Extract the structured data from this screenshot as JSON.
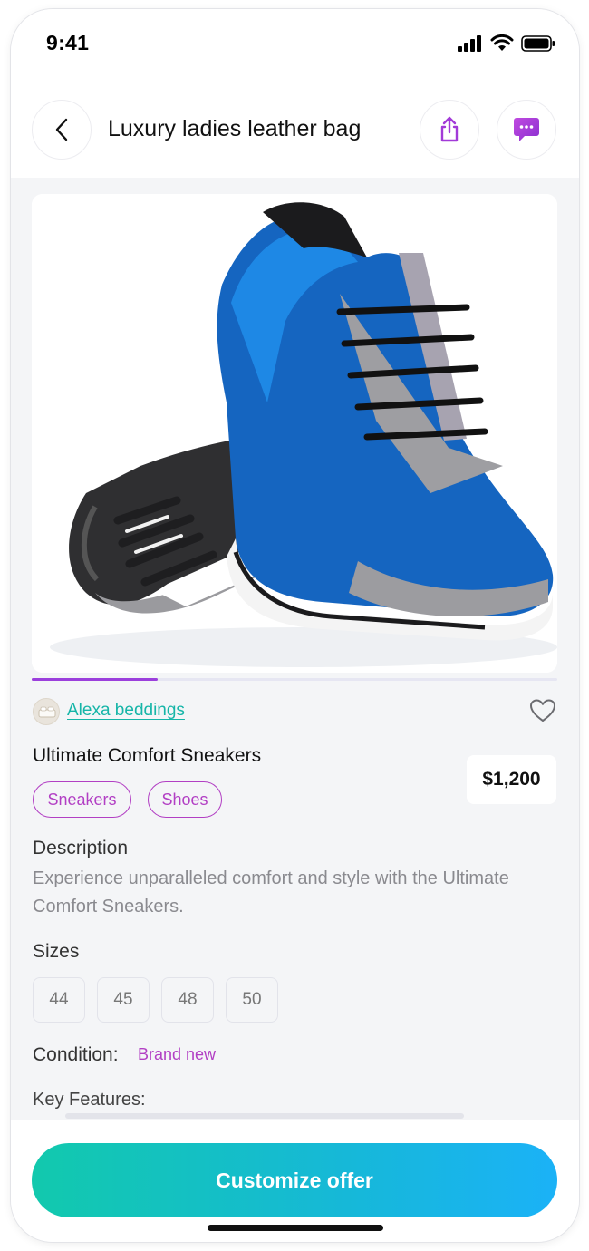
{
  "status_bar": {
    "time": "9:41"
  },
  "header": {
    "title": "Luxury ladies leather bag"
  },
  "gallery": {
    "progress": 0.24
  },
  "seller": {
    "name": "Alexa beddings"
  },
  "product": {
    "title": "Ultimate Comfort Sneakers",
    "price": "$1,200",
    "tags": [
      "Sneakers",
      "Shoes"
    ],
    "description_label": "Description",
    "description": "Experience unparalleled comfort and style with the Ultimate Comfort Sneakers.",
    "sizes_label": "Sizes",
    "sizes": [
      "44",
      "45",
      "48",
      "50"
    ],
    "condition_label": "Condition:",
    "condition_value": "Brand new",
    "features_label": "Key Features:"
  },
  "cta": {
    "label": "Customize offer"
  },
  "colors": {
    "accent": "#b23fc4",
    "seller_link": "#16b5a8",
    "cta_start": "#12c9ad",
    "cta_end": "#1bb2f7",
    "progress": "#9b3fdc"
  },
  "icons": {
    "back": "chevron-left-icon",
    "share": "share-icon",
    "chat": "chat-bubble-icon",
    "favorite": "heart-icon",
    "signal": "cellular-signal-icon",
    "wifi": "wifi-icon",
    "battery": "battery-icon"
  }
}
